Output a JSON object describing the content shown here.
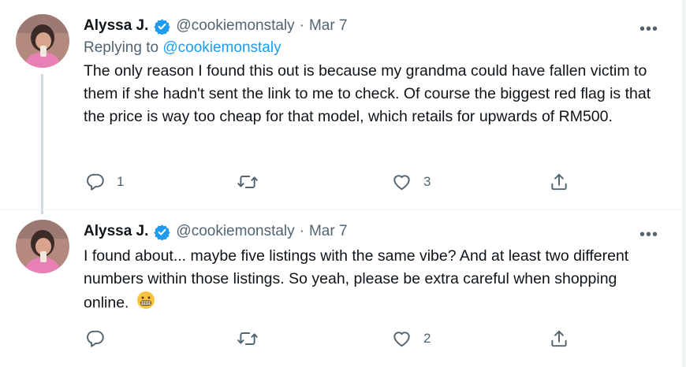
{
  "tweets": [
    {
      "name": "Alyssa J.",
      "handle": "@cookiemonstaly",
      "separator": "·",
      "date": "Mar 7",
      "more": "•••",
      "replying_prefix": "Replying to",
      "replying_to": "@cookiemonstaly",
      "text": "The only reason I found this out is because my grandma could have fallen victim to them if she hadn't sent the link to me to check. Of course the biggest red flag is that the price is way too cheap for that model, which retails for upwards of RM500.",
      "reply_count": "1",
      "retweet_count": "",
      "like_count": "3"
    },
    {
      "name": "Alyssa J.",
      "handle": "@cookiemonstaly",
      "separator": "·",
      "date": "Mar 7",
      "more": "•••",
      "text": "I found about... maybe five listings with the same vibe? And at least two different numbers within those listings. So yeah, please be extra careful when shopping online.",
      "emoji": "grimacing-face-emoji",
      "reply_count": "",
      "retweet_count": "",
      "like_count": "2"
    }
  ],
  "colors": {
    "text": "#0f1419",
    "muted": "#536471",
    "accent": "#1d9bf0",
    "thread_line": "#cfd9de",
    "divider": "#eff3f4"
  },
  "icons": [
    "verified-badge-icon",
    "more-icon",
    "reply-icon",
    "retweet-icon",
    "like-icon",
    "share-icon"
  ]
}
